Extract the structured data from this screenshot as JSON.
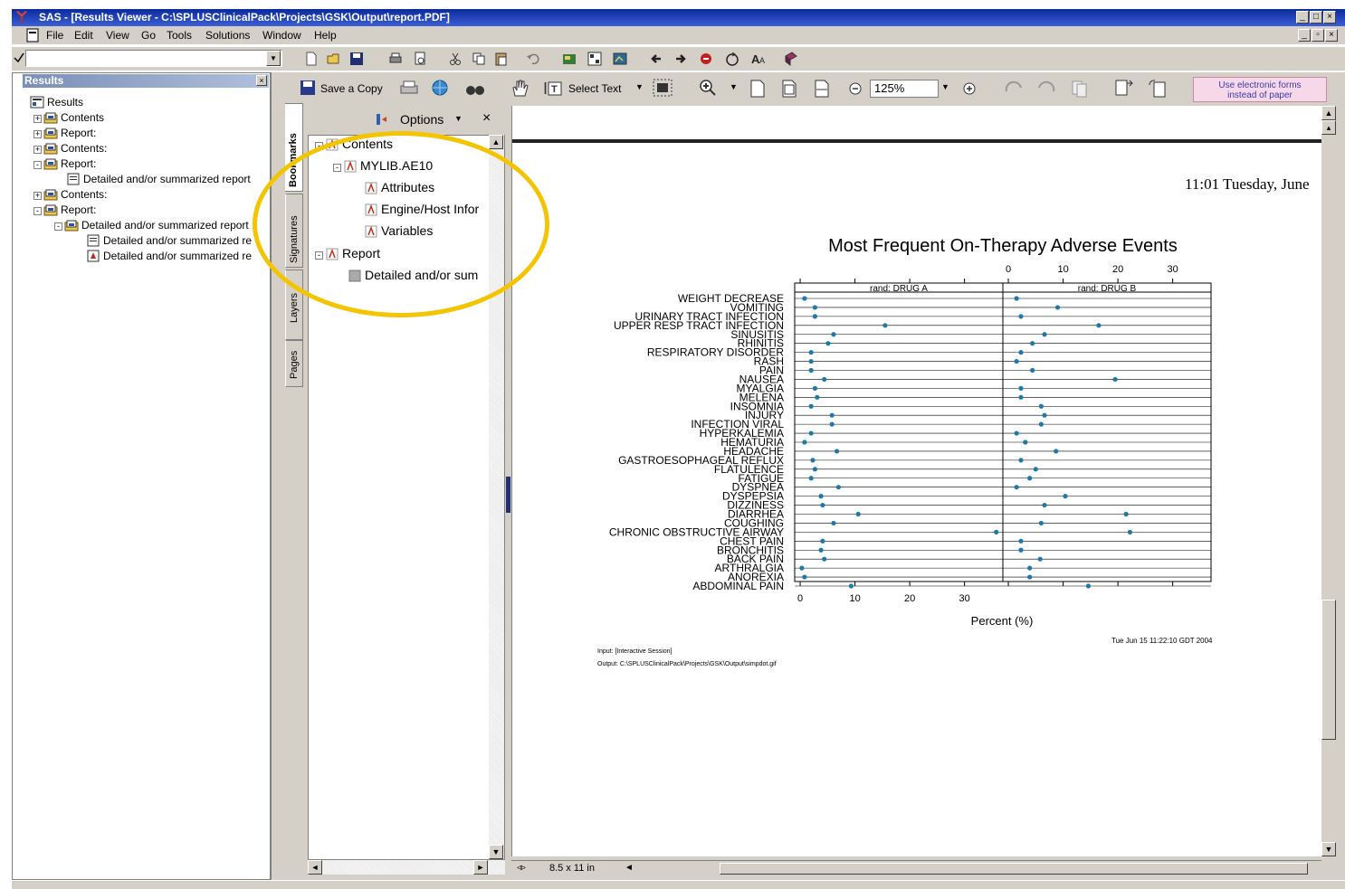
{
  "window": {
    "title": "SAS - [Results Viewer - C:\\SPLUSClinicalPack\\Projects\\GSK\\Output\\report.PDF]"
  },
  "menu": [
    "File",
    "Edit",
    "View",
    "Go",
    "Tools",
    "Solutions",
    "Window",
    "Help"
  ],
  "command_box": {
    "value": ""
  },
  "results": {
    "header": "Results",
    "root": "Results",
    "items": [
      {
        "label": "Contents",
        "level": 1,
        "expander": "+"
      },
      {
        "label": "Report:",
        "level": 1,
        "expander": "+"
      },
      {
        "label": "Contents:",
        "level": 1,
        "expander": "+"
      },
      {
        "label": "Report:",
        "level": 1,
        "expander": "-"
      },
      {
        "label": "Detailed and/or summarized report",
        "level": 2,
        "expander": ""
      },
      {
        "label": "Contents:",
        "level": 1,
        "expander": "+"
      },
      {
        "label": "Report:",
        "level": 1,
        "expander": "-"
      },
      {
        "label": "Detailed and/or summarized report",
        "level": 2,
        "expander": "-"
      },
      {
        "label": "Detailed and/or summarized re",
        "level": 3,
        "expander": ""
      },
      {
        "label": "Detailed and/or summarized re",
        "level": 3,
        "expander": ""
      }
    ]
  },
  "acrobat_toolbar": {
    "save_copy": "Save a Copy",
    "select_text": "Select Text",
    "zoom": "125%",
    "electronic_forms_line1": "Use electronic forms",
    "electronic_forms_line2": "instead of paper"
  },
  "side_tabs": [
    "Bookmarks",
    "Signatures",
    "Layers",
    "Pages"
  ],
  "bookmarks": {
    "options": "Options",
    "items": [
      {
        "label": "Contents",
        "level": 0
      },
      {
        "label": "MYLIB.AE10",
        "level": 1
      },
      {
        "label": "Attributes",
        "level": 2
      },
      {
        "label": "Engine/Host Infor",
        "level": 2
      },
      {
        "label": "Variables",
        "level": 2
      },
      {
        "label": "Report",
        "level": 0
      },
      {
        "label": "Detailed and/or sum",
        "level": 1
      }
    ]
  },
  "document": {
    "timestamp_header": "11:01 Tuesday, June",
    "footer_date": "Tue Jun 15 11:22:10 GDT 2004",
    "input_line": "Input: [Interactive Session]",
    "output_line": "Output: C:\\SPLUSClinicalPack\\Projects\\GSK\\Output\\simpdot.gif",
    "page_size": "8.5 x 11 in"
  },
  "chart_data": {
    "type": "scatter",
    "title": "Most Frequent On-Therapy Adverse Events",
    "xlabel": "Percent (%)",
    "xlim": [
      -1,
      37
    ],
    "xticks": [
      0,
      10,
      20,
      30
    ],
    "panels": [
      "rand: DRUG A",
      "rand: DRUG B"
    ],
    "marker_color": "#1f78a8",
    "categories": [
      "WEIGHT DECREASE",
      "VOMITING",
      "URINARY TRACT INFECTION",
      "UPPER RESP TRACT INFECTION",
      "SINUSITIS",
      "RHINITIS",
      "RESPIRATORY DISORDER",
      "RASH",
      "PAIN",
      "NAUSEA",
      "MYALGIA",
      "MELENA",
      "INSOMNIA",
      "INJURY",
      "INFECTION VIRAL",
      "HYPERKALEMIA",
      "HEMATURIA",
      "HEADACHE",
      "GASTROESOPHAGEAL REFLUX",
      "FLATULENCE",
      "FATIGUE",
      "DYSPNEA",
      "DYSPEPSIA",
      "DIZZINESS",
      "DIARRHEA",
      "COUGHING",
      "CHRONIC OBSTRUCTIVE AIRWAY",
      "CHEST PAIN",
      "BRONCHITIS",
      "BACK PAIN",
      "ARTHRALGIA",
      "ANOREXIA",
      "ABDOMINAL PAIN"
    ],
    "series": [
      {
        "name": "rand: DRUG A",
        "values": [
          0.8,
          2.7,
          2.7,
          15.5,
          6.1,
          5.1,
          2.0,
          2.0,
          2.0,
          4.4,
          2.7,
          3.1,
          2.0,
          5.8,
          5.8,
          2.0,
          0.8,
          6.7,
          2.3,
          2.7,
          2.0,
          7.0,
          3.8,
          4.1,
          10.6,
          6.1,
          35.8,
          4.1,
          3.8,
          4.4,
          0.3,
          0.8,
          9.3
        ]
      },
      {
        "name": "rand: DRUG B",
        "values": [
          1.5,
          9.0,
          2.3,
          16.5,
          6.6,
          4.4,
          2.3,
          1.5,
          4.4,
          19.5,
          2.3,
          2.3,
          6.0,
          6.6,
          6.0,
          1.5,
          3.1,
          8.7,
          2.3,
          5.0,
          3.9,
          1.5,
          10.4,
          6.6,
          21.5,
          6.0,
          22.2,
          2.3,
          2.3,
          5.8,
          3.9,
          3.9,
          14.6
        ]
      }
    ]
  }
}
